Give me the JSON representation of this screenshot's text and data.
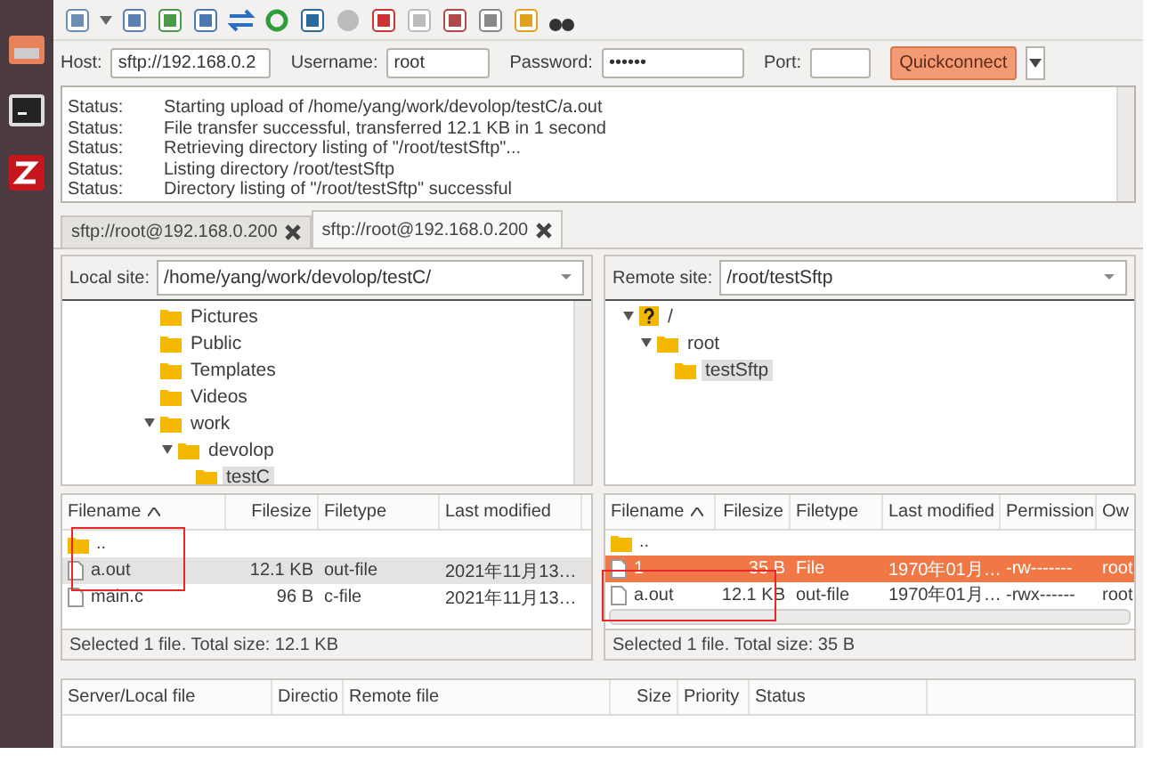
{
  "quickconnect": {
    "fields": [
      {
        "label": "Host:",
        "value": "sftp://192.168.0.2"
      },
      {
        "label": "Username:",
        "value": "root"
      },
      {
        "label": "Password:",
        "value": "••••••"
      },
      {
        "label": "Port:"
      }
    ],
    "button": "Quickconnect"
  },
  "log": [
    {
      "label": "Status:",
      "message": "Starting upload of /home/yang/work/devolop/testC/a.out"
    },
    {
      "label": "Status:",
      "message": "File transfer successful, transferred 12.1 KB in 1 second"
    },
    {
      "label": "Status:",
      "message": "Retrieving directory listing of \"/root/testSftp\"..."
    },
    {
      "label": "Status:",
      "message": "Listing directory /root/testSftp"
    },
    {
      "label": "Status:",
      "message": "Directory listing of \"/root/testSftp\" successful"
    }
  ],
  "tabs": [
    {
      "label": "sftp://root@192.168.0.200",
      "selected": false
    },
    {
      "label": "sftp://root@192.168.0.200",
      "selected": true
    }
  ],
  "panes": [
    {
      "site_label": "Local site:",
      "path": "/home/yang/work/devolop/testC/",
      "focused": false,
      "tree": [
        {
          "label": "Pictures",
          "expanded": false,
          "selected": false
        },
        {
          "label": "Public",
          "expanded": false,
          "selected": false
        },
        {
          "label": "Templates",
          "expanded": false,
          "selected": false
        },
        {
          "label": "Videos",
          "expanded": false,
          "selected": false
        },
        {
          "label": "work",
          "expanded": true,
          "selected": false,
          "children": [
            {
              "label": "devolop",
              "expanded": true,
              "selected": false,
              "children": [
                {
                  "label": "testC",
                  "expanded": false,
                  "selected": true
                }
              ]
            }
          ]
        }
      ],
      "columns": [
        "Filename",
        "Filesize",
        "Filetype",
        "Last modified"
      ],
      "rows": [
        {
          "kind": "folder",
          "selected": false,
          "cells": [
            ".."
          ]
        },
        {
          "kind": "file",
          "selected": true,
          "cells": [
            "a.out",
            "12.1 KB",
            "out-file",
            "2021年11月13…"
          ]
        },
        {
          "kind": "file",
          "selected": false,
          "cells": [
            "main.c",
            "96 B",
            "c-file",
            "2021年11月13…"
          ]
        }
      ],
      "status": "Selected 1 file. Total size: 12.1 KB"
    },
    {
      "site_label": "Remote site:",
      "path": "/root/testSftp",
      "focused": true,
      "tree": [
        {
          "label": "/",
          "kind": "unknown",
          "expanded": true,
          "selected": false,
          "children": [
            {
              "label": "root",
              "expanded": true,
              "selected": false,
              "children": [
                {
                  "label": "testSftp",
                  "expanded": false,
                  "selected": true
                }
              ]
            }
          ]
        }
      ],
      "columns": [
        "Filename",
        "Filesize",
        "Filetype",
        "Last modified",
        "Permission",
        "Ow"
      ],
      "rows": [
        {
          "kind": "folder",
          "selected": false,
          "cells": [
            ".."
          ]
        },
        {
          "kind": "file",
          "selected": true,
          "cells": [
            "1",
            "35 B",
            "File",
            "1970年01月…",
            "-rw-------",
            "root"
          ]
        },
        {
          "kind": "file",
          "selected": false,
          "cells": [
            "a.out",
            "12.1 KB",
            "out-file",
            "1970年01月…",
            "-rwx------",
            "root"
          ]
        }
      ],
      "status": "Selected 1 file. Total size: 35 B"
    }
  ],
  "queue": {
    "columns": [
      "Server/Local file",
      "Directio",
      "Remote file",
      "Size",
      "Priority",
      "Status"
    ]
  }
}
